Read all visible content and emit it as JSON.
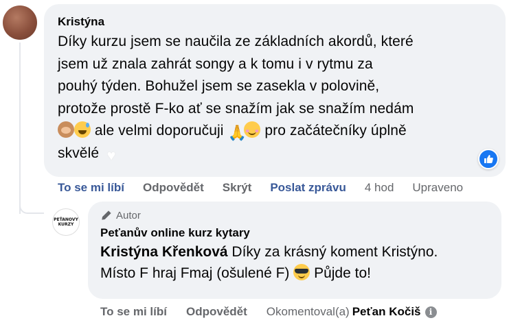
{
  "main_comment": {
    "author": "Kristýna",
    "text_line1": "Díky kurzu jsem se naučila ze základních akordů, které",
    "text_line2": "jsem už znala zahrát songy a k tomu i v rytmu za",
    "text_line3": "pouhý týden. Bohužel jsem se zasekla v polovině,",
    "text_line4": "protože prostě F-ko ať se snažím jak se snažím nedám",
    "text_line5_a": " ale velmi doporučuji ",
    "text_line5_b": " pro začátečníky úplně",
    "text_line6": "skvělé",
    "reaction_icon": "thumbs-up-icon"
  },
  "main_actions": {
    "like": "To se mi líbí",
    "reply": "Odpovědět",
    "hide": "Skrýt",
    "message": "Poslat zprávu",
    "time": "4 hod",
    "edited": "Upraveno"
  },
  "reply_comment": {
    "avatar_line1": "PEŤANOVY",
    "avatar_line2": "KURZY",
    "author_badge": "Autor",
    "author": "Peťanův online kurz kytary",
    "mention": "Kristýna Křenková",
    "text_line1": " Díky za krásný koment Kristýno.",
    "text_line2_a": "Místo  F  hraj  Fmaj (ošulené F) ",
    "text_line2_b": " Půjde to!"
  },
  "reply_actions": {
    "like": "To se mi líbí",
    "reply": "Odpovědět",
    "commented_by": "Okomentoval(a)",
    "commenter": "Peťan Kočiš",
    "info": "i"
  },
  "colors": {
    "bubble": "#f0f2f5",
    "link": "#385898",
    "muted": "#65676b",
    "like_badge": "#1877f2"
  }
}
